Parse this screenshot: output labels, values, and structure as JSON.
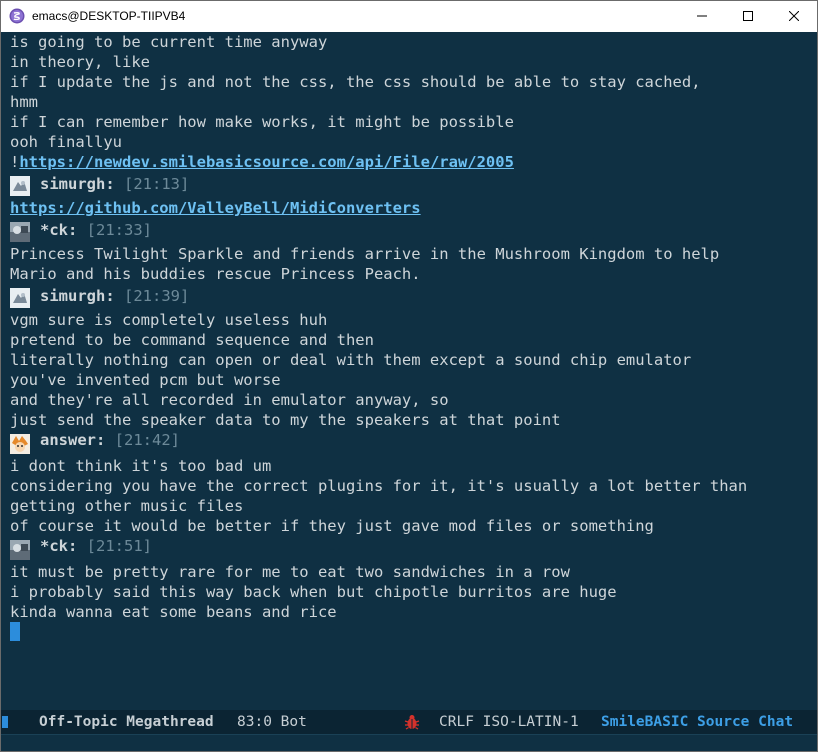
{
  "window": {
    "title": "emacs@DESKTOP-TIIPVB4",
    "icon": "emacs-icon",
    "controls": [
      "minimize-icon",
      "maximize-icon",
      "close-icon"
    ]
  },
  "chat": {
    "lines": [
      "is going to be current time anyway",
      "in theory, like",
      "if I update the js and not the css, the css should be able to stay cached,",
      "hmm",
      "if I can remember how make works, it might be possible",
      "ooh finallyu"
    ],
    "link1_prefix": "!",
    "link1": "https://newdev.smilebasicsource.com/api/File/raw/2005",
    "messages": [
      {
        "nick": "simurgh:",
        "time": "[21:13]",
        "avatar": "simurgh-avatar",
        "link": "https://github.com/ValleyBell/MidiConverters"
      },
      {
        "nick": "*ck:",
        "time": "[21:33]",
        "avatar": "ck-avatar",
        "lines": [
          "Princess Twilight Sparkle and friends arrive in the Mushroom Kingdom to help",
          "Mario and his buddies rescue Princess Peach."
        ]
      },
      {
        "nick": "simurgh:",
        "time": "[21:39]",
        "avatar": "simurgh-avatar",
        "lines": [
          "vgm sure is completely useless huh",
          "pretend to be command sequence and then",
          "literally nothing can open or deal with them except a sound chip emulator",
          "you've invented pcm but worse",
          "and they're all recorded in emulator anyway, so",
          "just send the speaker data to my the speakers at that point"
        ]
      },
      {
        "nick": "answer:",
        "time": "[21:42]",
        "avatar": "answer-avatar",
        "lines": [
          "i dont think it's too bad um",
          "considering you have the correct plugins for it, it's usually a lot better than",
          "getting other music files",
          "of course it would be better if they just gave mod files or something"
        ]
      },
      {
        "nick": "*ck:",
        "time": "[21:51]",
        "avatar": "ck-avatar",
        "lines": [
          "it must be pretty rare for me to eat two sandwiches in a row",
          "i probably said this way back when but chipotle burritos are huge",
          "kinda wanna eat some beans and rice"
        ]
      }
    ]
  },
  "modeline": {
    "buffer_name": "Off-Topic Megathread",
    "position": "83:0 Bot",
    "encoding": "CRLF ISO-LATIN-1",
    "mode": "SmileBASIC Source Chat",
    "bug_icon": "bug-icon"
  },
  "colors": {
    "background": "#0f3043",
    "text": "#ced5d9",
    "link": "#6ec1f3",
    "timestamp": "#6d8a99",
    "accent": "#3d9fe6",
    "bug": "#d4322c"
  }
}
